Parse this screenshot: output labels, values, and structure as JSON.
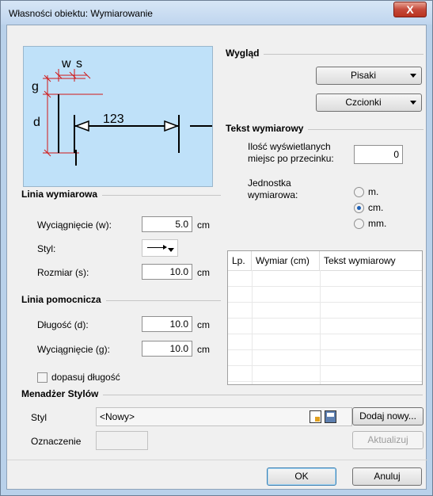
{
  "window": {
    "title": "Własności obiektu: Wymiarowanie",
    "close_glyph": "X"
  },
  "preview": {
    "label_w": "w",
    "label_s": "s",
    "label_g": "g",
    "label_d": "d",
    "dimension_value": "123"
  },
  "linia_wymiarowa": {
    "title": "Linia wymiarowa",
    "extension_label": "Wyciągnięcie (w):",
    "extension_value": "5.0",
    "extension_unit": "cm",
    "style_label": "Styl:",
    "size_label": "Rozmiar (s):",
    "size_value": "10.0",
    "size_unit": "cm"
  },
  "linia_pomocnicza": {
    "title": "Linia pomocnicza",
    "length_label": "Długość (d):",
    "length_value": "10.0",
    "length_unit": "cm",
    "extension_label": "Wyciągnięcie (g):",
    "extension_value": "10.0",
    "extension_unit": "cm",
    "fit_length_label": "dopasuj długość",
    "fit_length_checked": false
  },
  "wyglad": {
    "title": "Wygląd",
    "pens_label": "Pisaki",
    "fonts_label": "Czcionki"
  },
  "tekst_wymiarowy": {
    "title": "Tekst wymiarowy",
    "decimals_label_1": "Ilość wyświetlanych",
    "decimals_label_2": "miejsc po przecinku:",
    "decimals_value": "0",
    "unit_label_1": "Jednostka",
    "unit_label_2": "wymiarowa:",
    "units": [
      "m.",
      "cm.",
      "mm."
    ],
    "selected_unit": "cm."
  },
  "table": {
    "columns": [
      "Lp.",
      "Wymiar (cm)",
      "Tekst wymiarowy"
    ],
    "rows": []
  },
  "menadzer": {
    "title": "Menadżer Stylów",
    "style_label": "Styl",
    "style_value": "<Nowy>",
    "tag_label": "Oznaczenie",
    "tag_value": "",
    "add_new_label": "Dodaj nowy...",
    "update_label": "Aktualizuj"
  },
  "buttons": {
    "ok": "OK",
    "cancel": "Anuluj"
  },
  "colors": {
    "preview_bg": "#bfe1f9",
    "accent": "#1c5fb5",
    "close": "#c5493a",
    "dim_red": "#d01818"
  }
}
